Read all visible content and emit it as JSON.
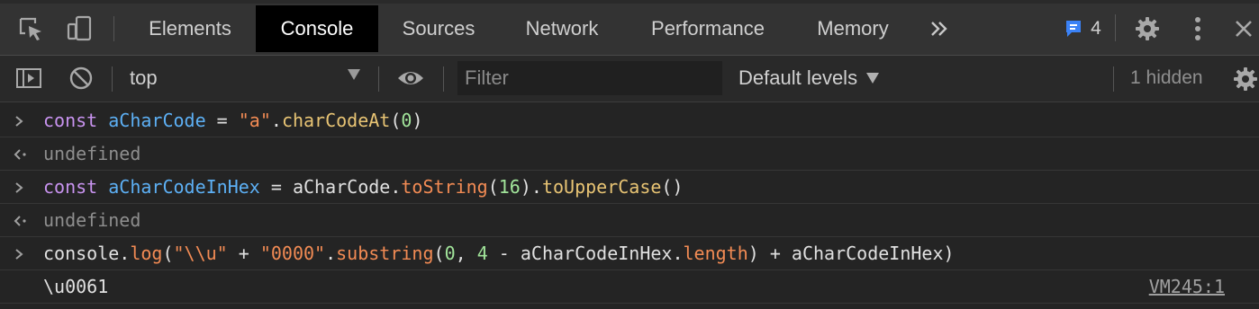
{
  "tabs": {
    "items": [
      "Elements",
      "Console",
      "Sources",
      "Network",
      "Performance",
      "Memory"
    ],
    "active": "Console",
    "more_icon": "chevron-double-right-icon"
  },
  "header_right": {
    "issues_count": "4",
    "issues_icon": "message-badge-icon",
    "settings_icon": "gear-icon",
    "menu_icon": "vertical-dots-icon",
    "close_icon": "close-icon"
  },
  "toolbar": {
    "context_value": "top",
    "filter_placeholder": "Filter",
    "levels_label": "Default levels",
    "hidden_label": "1 hidden"
  },
  "console": {
    "entries": [
      {
        "type": "input",
        "tokens": [
          {
            "t": "const",
            "c": "kw"
          },
          {
            "t": " ",
            "c": "plain"
          },
          {
            "t": "aCharCode",
            "c": "var"
          },
          {
            "t": " = ",
            "c": "plain"
          },
          {
            "t": "\"a\"",
            "c": "str"
          },
          {
            "t": ".",
            "c": "plain"
          },
          {
            "t": "charCodeAt",
            "c": "fn"
          },
          {
            "t": "(",
            "c": "plain"
          },
          {
            "t": "0",
            "c": "num"
          },
          {
            "t": ")",
            "c": "plain"
          }
        ]
      },
      {
        "type": "result",
        "text": "undefined"
      },
      {
        "type": "input",
        "tokens": [
          {
            "t": "const",
            "c": "kw"
          },
          {
            "t": " ",
            "c": "plain"
          },
          {
            "t": "aCharCodeInHex",
            "c": "var"
          },
          {
            "t": " = aCharCode.",
            "c": "plain"
          },
          {
            "t": "toString",
            "c": "str"
          },
          {
            "t": "(",
            "c": "plain"
          },
          {
            "t": "16",
            "c": "num"
          },
          {
            "t": ").",
            "c": "plain"
          },
          {
            "t": "toUpperCase",
            "c": "fn"
          },
          {
            "t": "()",
            "c": "plain"
          }
        ]
      },
      {
        "type": "result",
        "text": "undefined"
      },
      {
        "type": "input",
        "tokens": [
          {
            "t": "console.",
            "c": "plain"
          },
          {
            "t": "log",
            "c": "str"
          },
          {
            "t": "(",
            "c": "plain"
          },
          {
            "t": "\"\\\\u\"",
            "c": "str"
          },
          {
            "t": " + ",
            "c": "plain"
          },
          {
            "t": "\"0000\"",
            "c": "str"
          },
          {
            "t": ".",
            "c": "plain"
          },
          {
            "t": "substring",
            "c": "str"
          },
          {
            "t": "(",
            "c": "plain"
          },
          {
            "t": "0",
            "c": "num"
          },
          {
            "t": ", ",
            "c": "plain"
          },
          {
            "t": "4",
            "c": "num"
          },
          {
            "t": " - aCharCodeInHex.",
            "c": "plain"
          },
          {
            "t": "length",
            "c": "str"
          },
          {
            "t": ") + aCharCodeInHex)",
            "c": "plain"
          }
        ]
      },
      {
        "type": "log",
        "text": "\\u0061",
        "source": "VM245:1"
      }
    ]
  },
  "colors": {
    "keyword": "#c893ef",
    "variable": "#5db0f5",
    "string": "#f28b54",
    "function": "#e8c474",
    "number": "#a1e49a",
    "issues_blue": "#3b82f6"
  }
}
